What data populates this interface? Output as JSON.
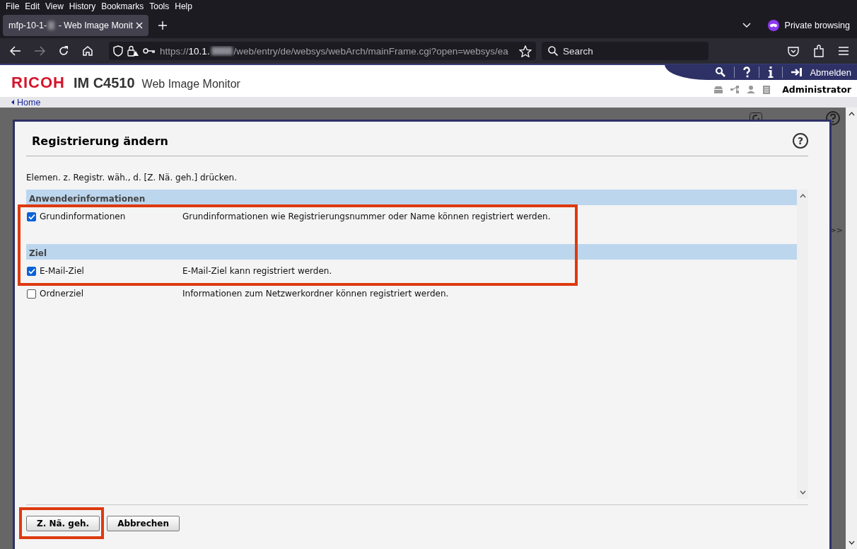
{
  "menu_bar": [
    "File",
    "Edit",
    "View",
    "History",
    "Bookmarks",
    "Tools",
    "Help"
  ],
  "tabs": [
    {
      "title": "mfp-10-1-",
      "title_rest": " - Web Image Monit",
      "selected": true
    }
  ],
  "private_label": "Private browsing",
  "address": {
    "prefix": "https://",
    "host": "10.1.",
    "path": "/web/entry/de/websys/webArch/mainFrame.cgi?open=websys/ea"
  },
  "search": {
    "placeholder": "Search"
  },
  "header": {
    "brand": "RICOH",
    "model": "IM C4510",
    "product": "Web Image Monitor",
    "logout": "Abmelden",
    "user": "Administrator"
  },
  "breadcrumb": "Home",
  "background_page": {
    "more": ">>"
  },
  "dialog": {
    "title": "Registrierung ändern",
    "help": "?",
    "instruction": "Elemen. z. Registr. wäh., d. [Z. Nä. geh.] drücken.",
    "sections": [
      {
        "heading": "Anwenderinformationen",
        "items": [
          {
            "label": "Grundinformationen",
            "description": "Grundinformationen wie Registrierungsnummer oder Name können registriert werden.",
            "checked": true
          }
        ]
      },
      {
        "heading": "Ziel",
        "items": [
          {
            "label": "E-Mail-Ziel",
            "description": "E-Mail-Ziel kann registriert werden.",
            "checked": true
          },
          {
            "label": "Ordnerziel",
            "description": "Informationen zum Netzwerkordner können registriert werden.",
            "checked": false
          }
        ]
      }
    ],
    "buttons": [
      "Z. Nä. geh.",
      "Abbrechen"
    ]
  }
}
